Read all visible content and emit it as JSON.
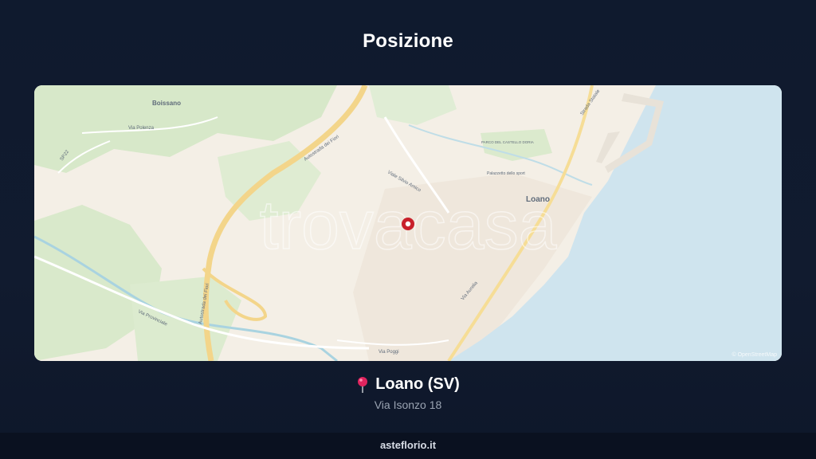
{
  "header": {
    "title": "Posizione"
  },
  "map": {
    "watermark": "trovacasa",
    "attribution": "© OpenStreetMap",
    "labels": {
      "boissano": "Boissano",
      "loano": "Loano",
      "via_polenza": "Via Polenza",
      "sp22": "SP22",
      "autostrada_1": "Autostrada dei Fiori",
      "autostrada_2": "Autostrada dei Fiori",
      "viale_silvio_amico": "Viale Silvio Amico",
      "via_aurelia": "Via Aurelia",
      "via_provinciale": "Via Provinciale",
      "via_poggi": "Via Poggi",
      "parco": "PARCO DEL CASTELLO DORIA",
      "palazzetto": "Palazzetto dello sport",
      "strada_statale": "Strada Statale"
    },
    "colors": {
      "sea": "#cfe4ee",
      "land": "#f4efe6",
      "green": "#d7e8c9",
      "highway": "#f3d58a",
      "marker": "#c8202a"
    }
  },
  "location": {
    "city": "Loano (SV)",
    "address": "Via Isonzo 18",
    "pin_icon": "round-pushpin-icon"
  },
  "footer": {
    "site": "asteflorio.it"
  }
}
